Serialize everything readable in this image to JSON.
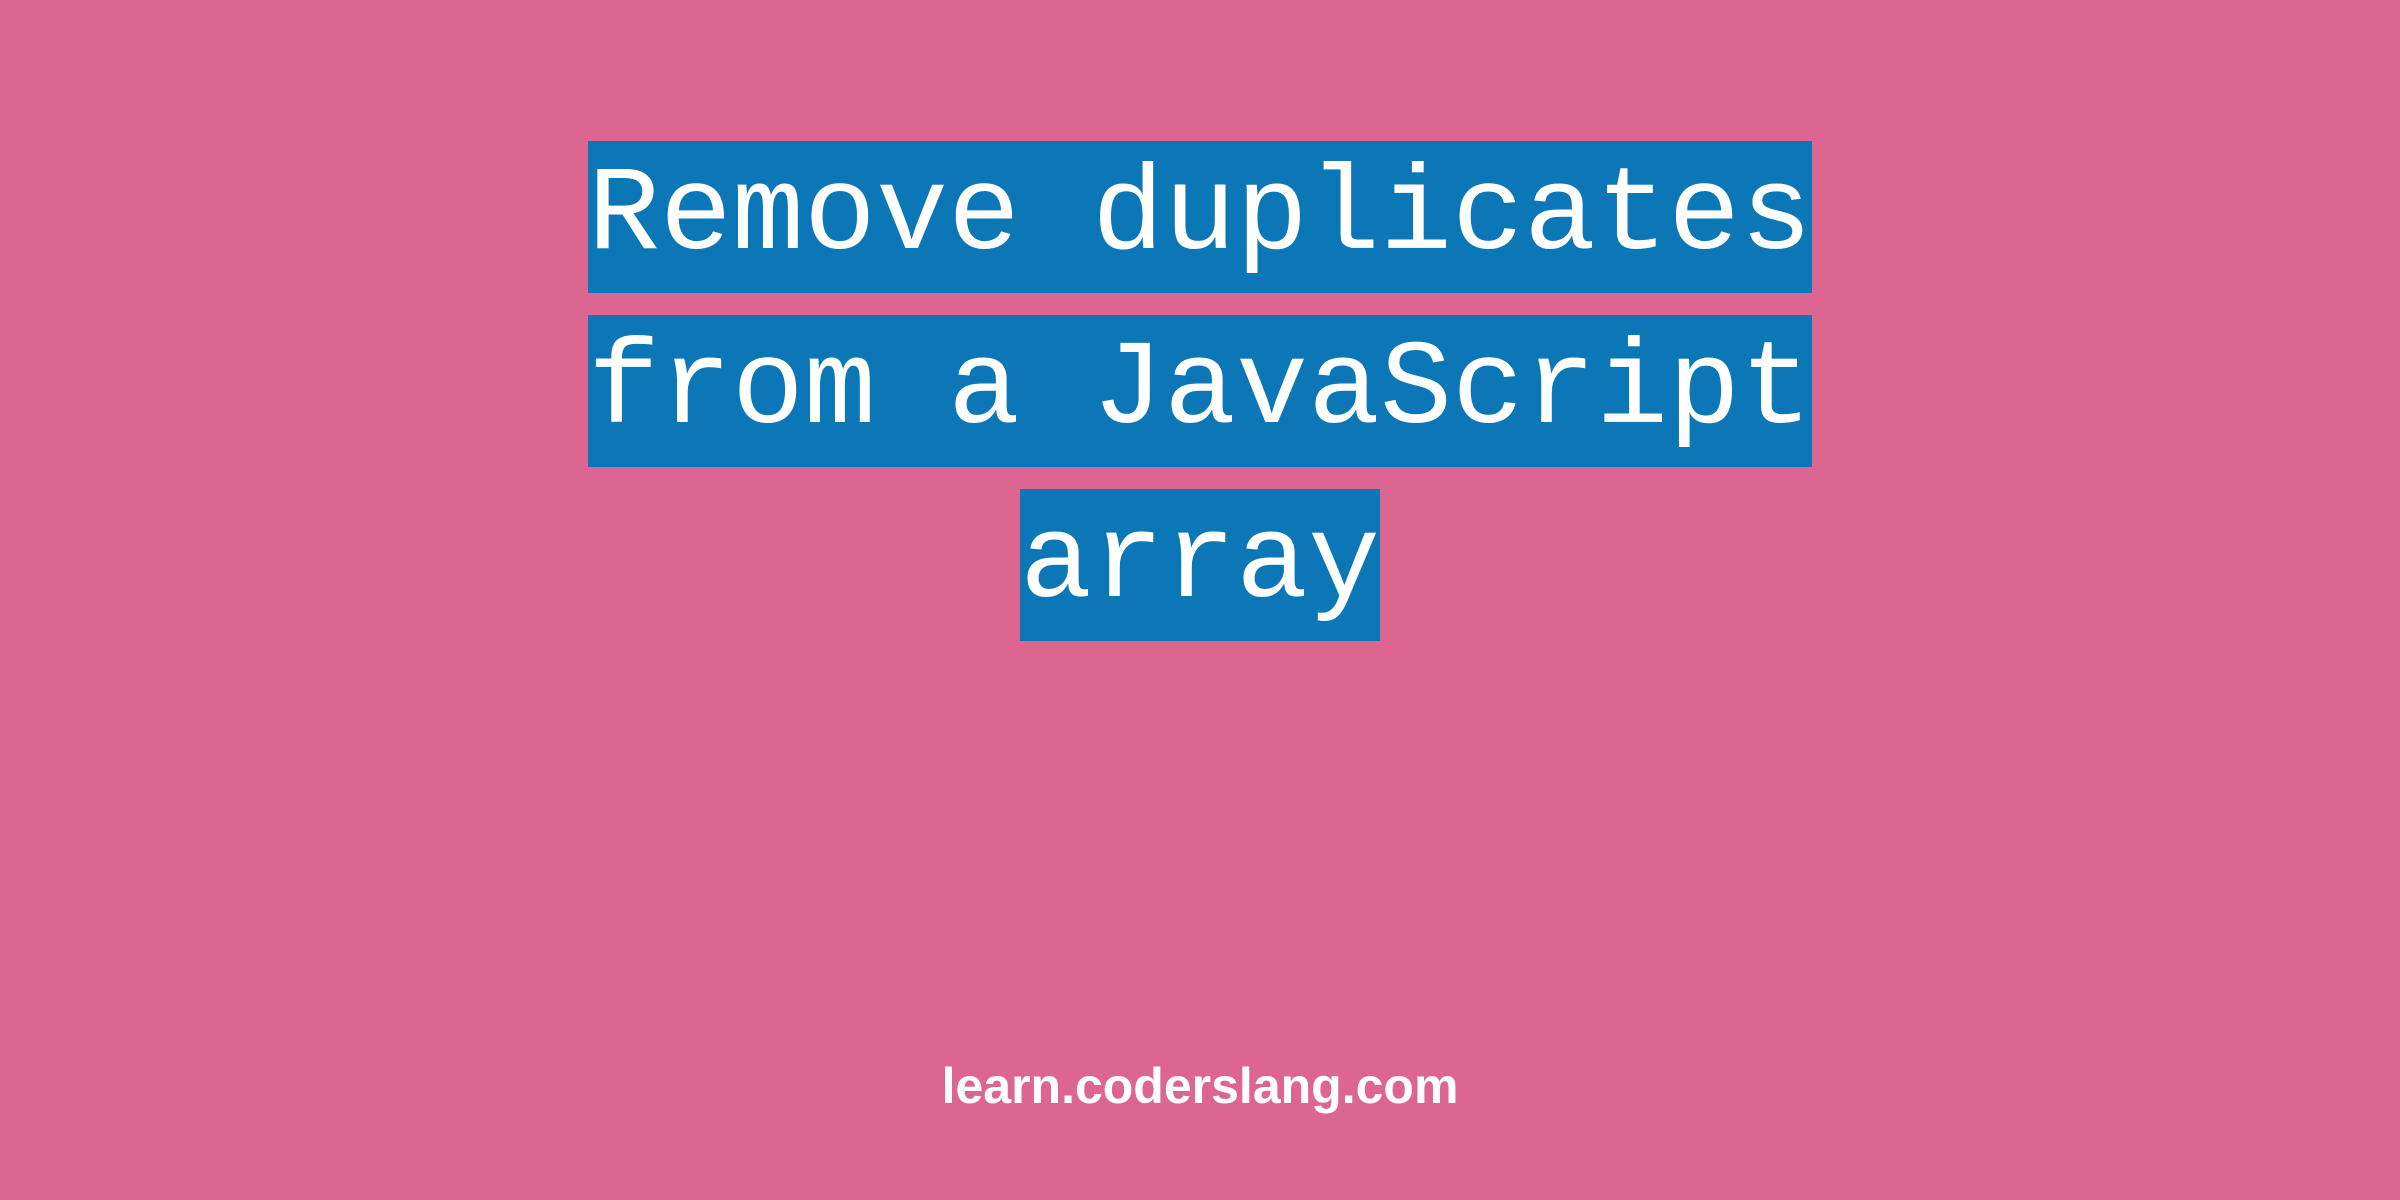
{
  "title": {
    "line1": "Remove duplicates",
    "line2": "from a JavaScript",
    "line3": "array"
  },
  "footer": {
    "text": "learn.coderslang.com"
  },
  "colors": {
    "background": "#dc6691",
    "highlight": "#0c77b6",
    "text": "#ffffff"
  }
}
